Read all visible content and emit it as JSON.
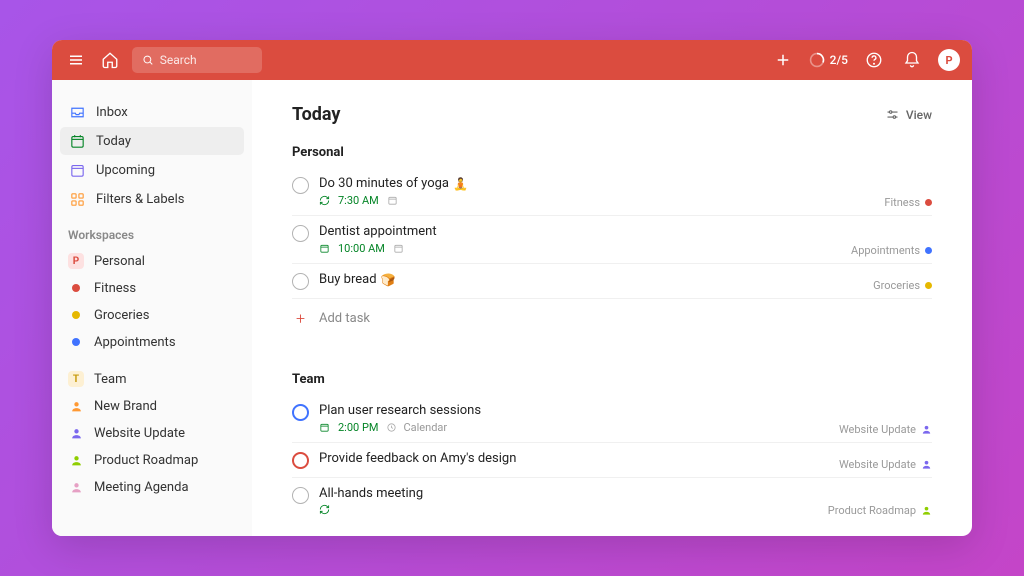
{
  "topbar": {
    "search_placeholder": "Search",
    "progress": "2/5",
    "avatar_initial": "P"
  },
  "sidebar": {
    "nav": [
      {
        "id": "inbox",
        "label": "Inbox"
      },
      {
        "id": "today",
        "label": "Today"
      },
      {
        "id": "upcoming",
        "label": "Upcoming"
      },
      {
        "id": "filters",
        "label": "Filters & Labels"
      }
    ],
    "workspaces_header": "Workspaces",
    "personal_ws": {
      "label": "Personal",
      "badge": "P",
      "badge_bg": "#fde1e1",
      "badge_fg": "#db4c3f",
      "projects": [
        {
          "label": "Fitness",
          "color": "#db4c3f"
        },
        {
          "label": "Groceries",
          "color": "#e6b800"
        },
        {
          "label": "Appointments",
          "color": "#4073ff"
        }
      ]
    },
    "team_ws": {
      "label": "Team",
      "badge": "T",
      "badge_bg": "#fdf0d3",
      "badge_fg": "#c89b0f",
      "projects": [
        {
          "label": "New Brand",
          "color": "#ff9933"
        },
        {
          "label": "Website Update",
          "color": "#7b68ee"
        },
        {
          "label": "Product Roadmap",
          "color": "#8fce00"
        },
        {
          "label": "Meeting Agenda",
          "color": "#e6a0c4"
        }
      ]
    }
  },
  "main": {
    "title": "Today",
    "view_label": "View",
    "sections": [
      {
        "name": "Personal",
        "tasks": [
          {
            "title": "Do 30 minutes of yoga",
            "emoji": "🧘",
            "recur": true,
            "time": "7:30 AM",
            "calendar_icon": true,
            "tag": "Fitness",
            "tag_color": "#db4c3f",
            "priority": "none"
          },
          {
            "title": "Dentist appointment",
            "emoji": "",
            "recur": false,
            "time": "10:00 AM",
            "calendar_icon": true,
            "tag": "Appointments",
            "tag_color": "#4073ff",
            "priority": "none"
          },
          {
            "title": "Buy bread",
            "emoji": "🍞",
            "recur": false,
            "time": "",
            "calendar_icon": false,
            "tag": "Groceries",
            "tag_color": "#e6b800",
            "priority": "none"
          }
        ]
      },
      {
        "name": "Team",
        "tasks": [
          {
            "title": "Plan user research sessions",
            "emoji": "",
            "recur": false,
            "time": "2:00 PM",
            "calendar_note": "Calendar",
            "tag": "Website Update",
            "tag_person": true,
            "priority": "blue"
          },
          {
            "title": "Provide feedback on Amy's design",
            "emoji": "",
            "recur": false,
            "time": "",
            "tag": "Website Update",
            "tag_person": true,
            "priority": "red"
          },
          {
            "title": "All-hands meeting",
            "emoji": "",
            "recur": true,
            "time": "",
            "tag": "Product Roadmap",
            "tag_person": true,
            "priority": "none"
          }
        ]
      }
    ],
    "add_task_label": "Add task"
  }
}
